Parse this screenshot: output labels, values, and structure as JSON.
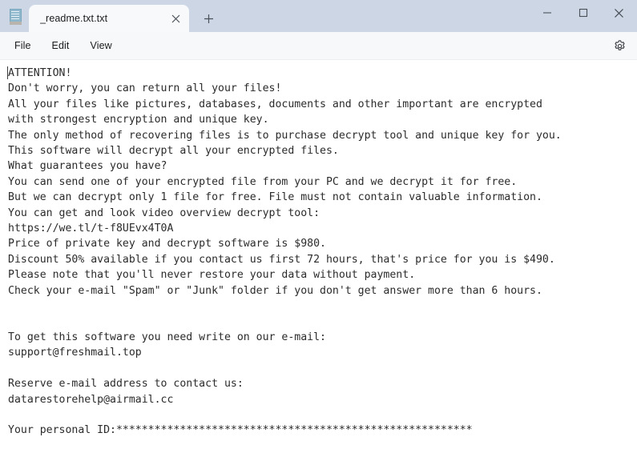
{
  "window": {
    "app_icon": "notepad-document-icon",
    "tab": {
      "title": "_readme.txt.txt",
      "close_label": "Close tab",
      "icon": "close-icon"
    },
    "new_tab": {
      "label": "New tab",
      "icon": "plus-icon"
    },
    "controls": {
      "minimize": {
        "label": "Minimize",
        "icon": "minimize-icon"
      },
      "maximize": {
        "label": "Maximize",
        "icon": "maximize-icon"
      },
      "close": {
        "label": "Close",
        "icon": "close-icon"
      }
    },
    "chrome_color": "#ccd6e4",
    "tab_active_color": "#f7f9fb"
  },
  "menubar": {
    "items": [
      {
        "label": "File"
      },
      {
        "label": "Edit"
      },
      {
        "label": "View"
      }
    ],
    "settings": {
      "label": "Settings",
      "icon": "gear-icon"
    },
    "background_color": "#f7f8fa"
  },
  "editor": {
    "text": "ATTENTION!\nDon't worry, you can return all your files!\nAll your files like pictures, databases, documents and other important are encrypted\nwith strongest encryption and unique key.\nThe only method of recovering files is to purchase decrypt tool and unique key for you.\nThis software will decrypt all your encrypted files.\nWhat guarantees you have?\nYou can send one of your encrypted file from your PC and we decrypt it for free.\nBut we can decrypt only 1 file for free. File must not contain valuable information.\nYou can get and look video overview decrypt tool:\nhttps://we.tl/t-f8UEvx4T0A\nPrice of private key and decrypt software is $980.\nDiscount 50% available if you contact us first 72 hours, that's price for you is $490.\nPlease note that you'll never restore your data without payment.\nCheck your e-mail \"Spam\" or \"Junk\" folder if you don't get answer more than 6 hours.\n\n\nTo get this software you need write on our e-mail:\nsupport@freshmail.top\n\nReserve e-mail address to contact us:\ndatarestorehelp@airmail.cc\n\nYour personal ID:********************************************************",
    "text_color": "#2b2b2b",
    "background_color": "#ffffff",
    "links": {
      "video_overview_url": "https://we.tl/t-f8UEvx4T0A",
      "primary_email": "support@freshmail.top",
      "reserve_email": "datarestorehelp@airmail.cc"
    },
    "amounts": {
      "full_price": "$980",
      "discount_price": "$490",
      "discount_percent": "50%",
      "discount_window_hours": "72",
      "answer_time_hours": "6",
      "free_files": "1"
    }
  }
}
